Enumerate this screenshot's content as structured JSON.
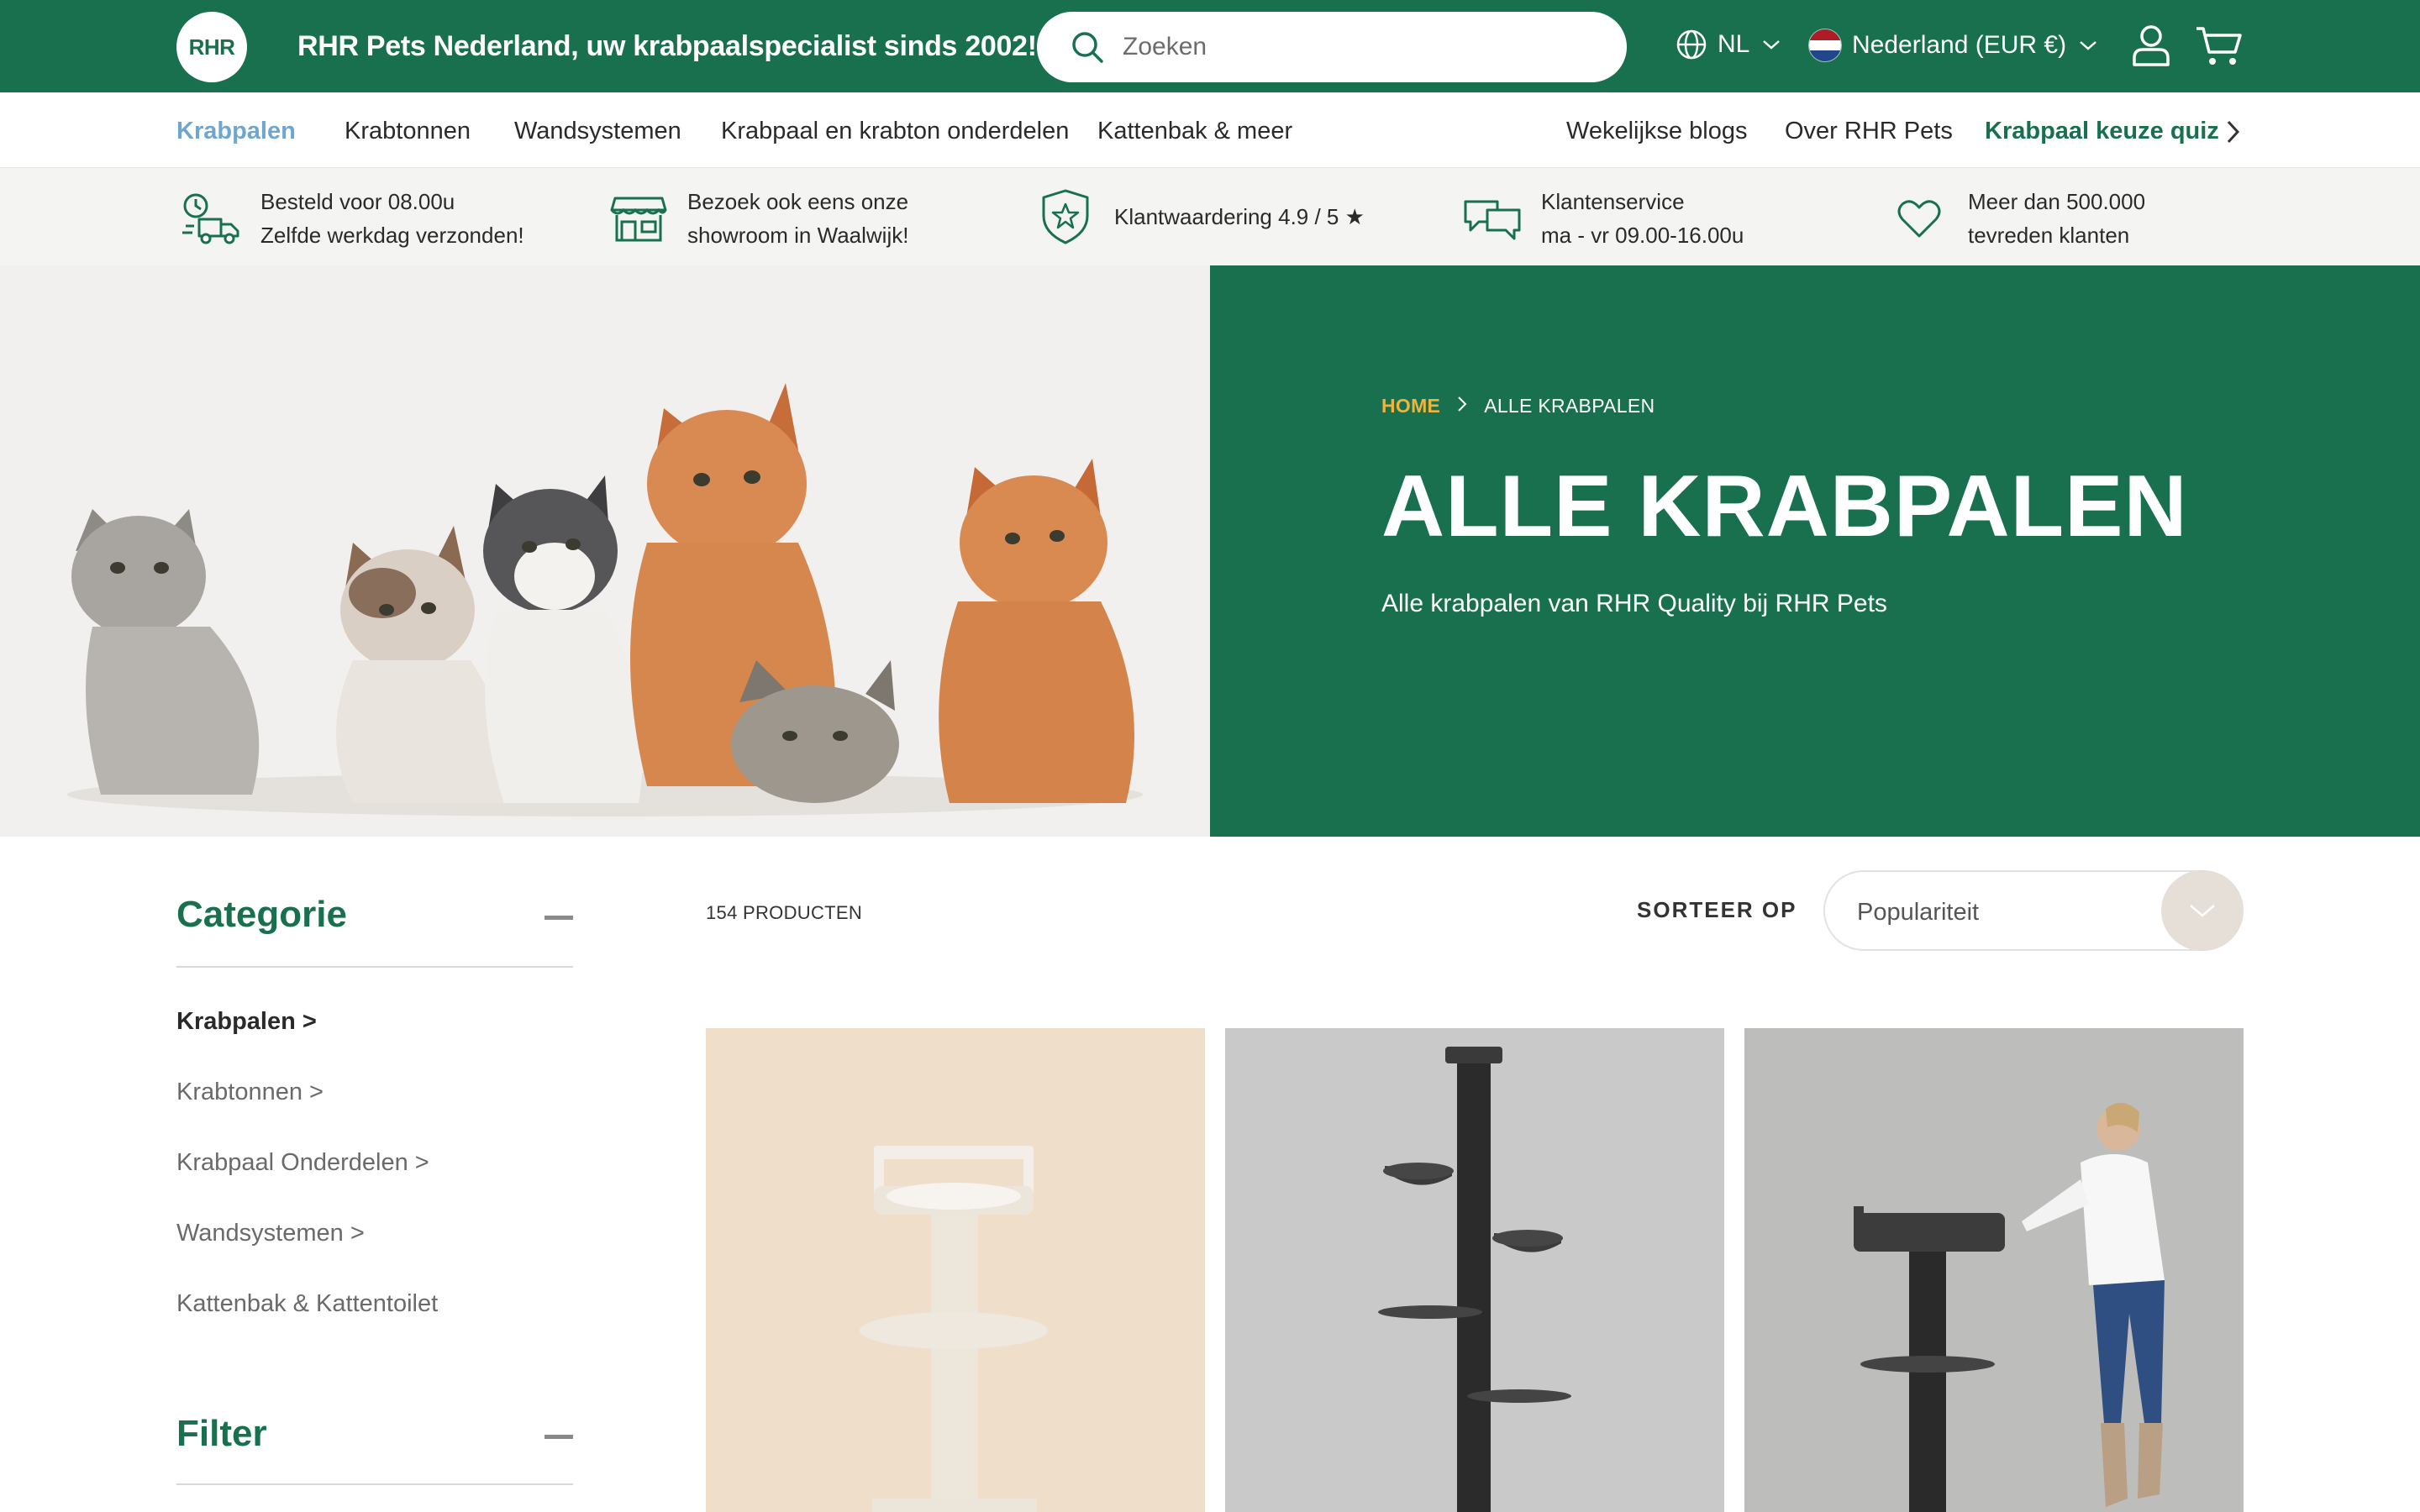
{
  "header": {
    "logo_text": "RHR",
    "tagline": "RHR Pets Nederland, uw krabpaalspecialist sinds 2002!",
    "search_placeholder": "Zoeken",
    "language": "NL",
    "country": "Nederland (EUR €)",
    "icons": [
      "search-icon",
      "globe-icon",
      "chevron-down-icon",
      "flag-nl-icon",
      "user-icon",
      "cart-icon"
    ],
    "brand_color": "#18704f"
  },
  "nav": {
    "items": [
      "Krabpalen",
      "Krabtonnen",
      "Wandsystemen",
      "Krabpaal en krabton onderdelen",
      "Kattenbak & meer"
    ],
    "right_items": [
      "Wekelijkse blogs",
      "Over RHR Pets"
    ],
    "quiz": "Krabpaal keuze quiz",
    "active_color": "#6fa6cf"
  },
  "usp": [
    {
      "line1": "Besteld voor 08.00u",
      "line2": "Zelfde werkdag verzonden!",
      "icon": "delivery-truck-icon"
    },
    {
      "line1": "Bezoek ook eens onze",
      "line2": "showroom in Waalwijk!",
      "icon": "store-icon"
    },
    {
      "line1": "Klantwaardering 4.9 / 5 ★",
      "line2": "",
      "icon": "star-shield-icon"
    },
    {
      "line1": "Klantenservice",
      "line2": "ma - vr 09.00-16.00u",
      "icon": "chat-icon"
    },
    {
      "line1": "Meer dan 500.000",
      "line2": "tevreden klanten",
      "icon": "heart-icon"
    }
  ],
  "hero": {
    "breadcrumb_home": "HOME",
    "breadcrumb_current": "ALLE KRABPALEN",
    "title": "ALLE KRABPALEN",
    "subtitle": "Alle krabpalen van RHR Quality bij RHR Pets",
    "breadcrumb_home_color": "#f0b43c"
  },
  "sidebar": {
    "category_title": "Categorie",
    "categories": [
      "Krabpalen >",
      "Krabtonnen >",
      "Krabpaal Onderdelen >",
      "Wandsystemen >",
      "Kattenbak & Kattentoilet"
    ],
    "filter_title": "Filter"
  },
  "products": {
    "count_label": "154 PRODUCTEN",
    "sort_label": "SORTEER OP",
    "sort_value": "Populariteit"
  }
}
